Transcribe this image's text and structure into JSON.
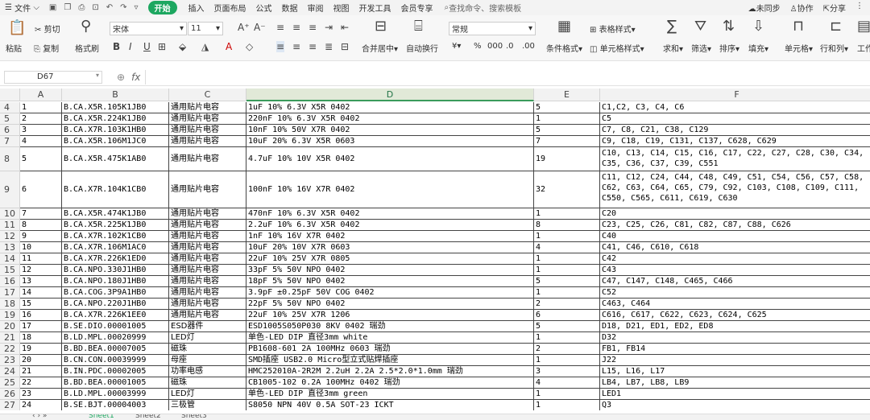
{
  "menu": {
    "file": "文件",
    "start": "开始",
    "tabs": [
      "插入",
      "页面布局",
      "公式",
      "数据",
      "审阅",
      "视图",
      "开发工具",
      "会员专享"
    ],
    "search": "查找命令、搜索模板",
    "right": [
      "未同步",
      "协作",
      "分享"
    ]
  },
  "ribbon": {
    "paste": "粘贴",
    "cut": "剪切",
    "copy": "复制",
    "format_painter": "格式刷",
    "font_name": "宋体",
    "font_size": "11",
    "number_format": "常规",
    "merge": "合并居中",
    "wrap": "自动换行",
    "table_style": "表格样式",
    "cond_format": "条件格式",
    "cell_style": "单元格样式",
    "sum": "求和",
    "filter": "筛选",
    "sort": "排序",
    "fill": "填充",
    "cell": "单元格",
    "rowcol": "行和列",
    "work": "工作"
  },
  "formula": {
    "namebox": "D67",
    "fx": "fx",
    "value": ""
  },
  "columns": [
    "A",
    "B",
    "C",
    "D",
    "E",
    "F"
  ],
  "active_col": "D",
  "rows": [
    {
      "n": "4",
      "a": "1",
      "b": "B.CA.X5R.105K1JB0",
      "c": "通用贴片电容",
      "d": "1uF 10% 6.3V X5R 0402",
      "e": "5",
      "f": "C1,C2, C3, C4, C6"
    },
    {
      "n": "5",
      "a": "2",
      "b": "B.CA.X5R.224K1JB0",
      "c": "通用贴片电容",
      "d": "220nF 10% 6.3V X5R 0402",
      "e": "1",
      "f": "C5"
    },
    {
      "n": "6",
      "a": "3",
      "b": "B.CA.X7R.103K1HB0",
      "c": "通用贴片电容",
      "d": "10nF 10% 50V X7R 0402",
      "e": "5",
      "f": "C7, C8, C21, C38, C129"
    },
    {
      "n": "7",
      "a": "4",
      "b": "B.CA.X5R.106M1JC0",
      "c": "通用贴片电容",
      "d": "10uF 20% 6.3V X5R 0603",
      "e": "7",
      "f": "C9, C18, C19, C131, C137, C628, C629"
    },
    {
      "n": "8",
      "a": "5",
      "b": "B.CA.X5R.475K1AB0",
      "c": "通用贴片电容",
      "d": "4.7uF 10% 10V X5R 0402",
      "e": "19",
      "f": "C10, C13, C14, C15, C16, C17, C22, C27, C28, C30, C34, C35, C36, C37, C39, C551"
    },
    {
      "n": "9",
      "a": "6",
      "b": "B.CA.X7R.104K1CB0",
      "c": "通用贴片电容",
      "d": "100nF 10% 16V X7R 0402",
      "e": "32",
      "f": "C11, C12, C24, C44, C48, C49, C51, C54, C56, C57, C58, C62, C63, C64, C65, C79, C92, C103, C108, C109, C111, C550, C565, C611, C619, C630"
    },
    {
      "n": "10",
      "a": "7",
      "b": "B.CA.X5R.474K1JB0",
      "c": "通用贴片电容",
      "d": "470nF 10% 6.3V X5R 0402",
      "e": "1",
      "f": "C20"
    },
    {
      "n": "11",
      "a": "8",
      "b": "B.CA.X5R.225K1JB0",
      "c": "通用贴片电容",
      "d": "2.2uF 10% 6.3V X5R 0402",
      "e": "8",
      "f": "C23, C25, C26, C81, C82, C87, C88, C626"
    },
    {
      "n": "12",
      "a": "9",
      "b": "B.CA.X7R.102K1CB0",
      "c": "通用贴片电容",
      "d": "1nF 10% 16V X7R 0402",
      "e": "1",
      "f": "C40"
    },
    {
      "n": "13",
      "a": "10",
      "b": "B.CA.X7R.106M1AC0",
      "c": "通用贴片电容",
      "d": "10uF 20% 10V X7R 0603",
      "e": "4",
      "f": "C41, C46, C610, C618"
    },
    {
      "n": "14",
      "a": "11",
      "b": "B.CA.X7R.226K1ED0",
      "c": "通用贴片电容",
      "d": "22uF 10% 25V X7R 0805",
      "e": "1",
      "f": "C42"
    },
    {
      "n": "15",
      "a": "12",
      "b": "B.CA.NPO.330J1HB0",
      "c": "通用贴片电容",
      "d": "33pF 5% 50V NPO 0402",
      "e": "1",
      "f": "C43"
    },
    {
      "n": "16",
      "a": "13",
      "b": "B.CA.NPO.180J1HB0",
      "c": "通用贴片电容",
      "d": "18pF 5% 50V NPO 0402",
      "e": "5",
      "f": "C47, C147, C148, C465, C466"
    },
    {
      "n": "17",
      "a": "14",
      "b": "B.CA.COG.3P9A1HB0",
      "c": "通用贴片电容",
      "d": "3.9pF ±0.25pF 50V COG 0402",
      "e": "1",
      "f": "C52"
    },
    {
      "n": "18",
      "a": "15",
      "b": "B.CA.NPO.220J1HB0",
      "c": "通用贴片电容",
      "d": "22pF 5% 50V NPO 0402",
      "e": "2",
      "f": "C463, C464"
    },
    {
      "n": "19",
      "a": "16",
      "b": "B.CA.X7R.226K1EE0",
      "c": "通用贴片电容",
      "d": "22uF 10% 25V X7R 1206",
      "e": "6",
      "f": "C616, C617, C622, C623, C624, C625"
    },
    {
      "n": "20",
      "a": "17",
      "b": "B.SE.DIO.00001005",
      "c": "ESD器件",
      "d": "ESD1005S050P030 8KV 0402 瑞劲",
      "e": "5",
      "f": "D18, D21, ED1, ED2, ED8"
    },
    {
      "n": "21",
      "a": "18",
      "b": "B.LD.MPL.00020999",
      "c": "LED灯",
      "d": "单色-LED DIP 直径3mm white",
      "e": "1",
      "f": "D32"
    },
    {
      "n": "22",
      "a": "19",
      "b": "B.BD.BEA.00007005",
      "c": "磁珠",
      "d": "PB1608-601 2A 100MHz 0603 瑞劲",
      "e": "2",
      "f": "FB1, FB14"
    },
    {
      "n": "23",
      "a": "20",
      "b": "B.CN.CON.00039999",
      "c": "母座",
      "d": "SMD插座 USB2.0 Micro型立式贴焊插座",
      "e": "1",
      "f": "J22"
    },
    {
      "n": "24",
      "a": "21",
      "b": "B.IN.PDC.00002005",
      "c": "功率电感",
      "d": "HMC252010A-2R2M 2.2uH 2.2A 2.5*2.0*1.0mm 瑞劲",
      "e": "3",
      "f": "L15, L16, L17"
    },
    {
      "n": "25",
      "a": "22",
      "b": "B.BD.BEA.00001005",
      "c": "磁珠",
      "d": "CB1005-102 0.2A 100MHz 0402 瑞劲",
      "e": "4",
      "f": "LB4, LB7, LB8, LB9"
    },
    {
      "n": "26",
      "a": "23",
      "b": "B.LD.MPL.00003999",
      "c": "LED灯",
      "d": "单色-LED DIP 直径3mm green",
      "e": "1",
      "f": "LED1"
    },
    {
      "n": "27",
      "a": "24",
      "b": "B.SE.BJT.00004003",
      "c": "三极管",
      "d": "S8050 NPN 40V 0.5A SOT-23 ICKT",
      "e": "1",
      "f": "Q3"
    }
  ],
  "sheets": [
    "Sheet1",
    "Sheet2",
    "Sheet3"
  ]
}
